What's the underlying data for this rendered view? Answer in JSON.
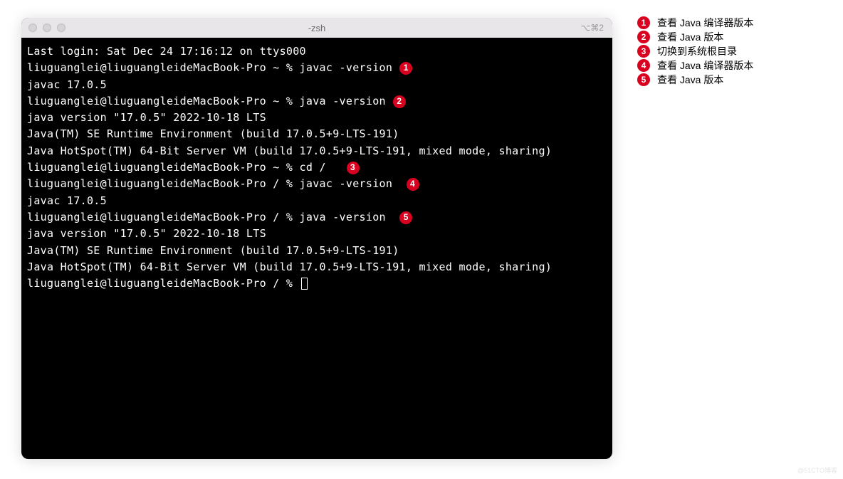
{
  "window": {
    "title": "-zsh",
    "shortcut": "⌥⌘2"
  },
  "terminal": {
    "lines": [
      {
        "text": "Last login: Sat Dec 24 17:16:12 on ttys000",
        "badge": null
      },
      {
        "text": "liuguanglei@liuguangleideMacBook-Pro ~ % javac -version",
        "badge": "1"
      },
      {
        "text": "javac 17.0.5",
        "badge": null
      },
      {
        "text": "liuguanglei@liuguangleideMacBook-Pro ~ % java -version",
        "badge": "2"
      },
      {
        "text": "java version \"17.0.5\" 2022-10-18 LTS",
        "badge": null
      },
      {
        "text": "Java(TM) SE Runtime Environment (build 17.0.5+9-LTS-191)",
        "badge": null
      },
      {
        "text": "Java HotSpot(TM) 64-Bit Server VM (build 17.0.5+9-LTS-191, mixed mode, sharing)",
        "badge": null
      },
      {
        "text": "liuguanglei@liuguangleideMacBook-Pro ~ % cd /  ",
        "badge": "3"
      },
      {
        "text": "liuguanglei@liuguangleideMacBook-Pro / % javac -version ",
        "badge": "4"
      },
      {
        "text": "javac 17.0.5",
        "badge": null
      },
      {
        "text": "liuguanglei@liuguangleideMacBook-Pro / % java -version ",
        "badge": "5"
      },
      {
        "text": "java version \"17.0.5\" 2022-10-18 LTS",
        "badge": null
      },
      {
        "text": "Java(TM) SE Runtime Environment (build 17.0.5+9-LTS-191)",
        "badge": null
      },
      {
        "text": "Java HotSpot(TM) 64-Bit Server VM (build 17.0.5+9-LTS-191, mixed mode, sharing)",
        "badge": null
      }
    ],
    "prompt_final": "liuguanglei@liuguangleideMacBook-Pro / % "
  },
  "legend": {
    "items": [
      {
        "num": "1",
        "text": "查看 Java 编译器版本"
      },
      {
        "num": "2",
        "text": "查看 Java 版本"
      },
      {
        "num": "3",
        "text": "切换到系统根目录"
      },
      {
        "num": "4",
        "text": "查看 Java 编译器版本"
      },
      {
        "num": "5",
        "text": "查看 Java 版本"
      }
    ]
  },
  "watermark": "@51CTO博客"
}
